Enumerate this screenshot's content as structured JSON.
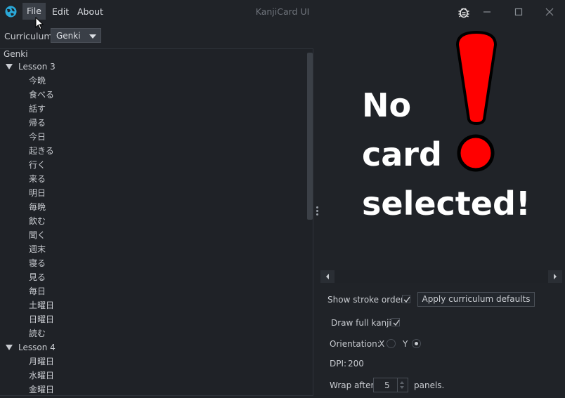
{
  "window": {
    "title": "KanjiCard UI",
    "menu": [
      "File",
      "Edit",
      "About"
    ]
  },
  "curriculum": {
    "label": "Curriculum",
    "selected": "Genki"
  },
  "tree": {
    "root": "Genki",
    "lessons": [
      {
        "label": "Lesson 3",
        "items": [
          "今晩",
          "食べる",
          "話す",
          "帰る",
          "今日",
          "起きる",
          "行く",
          "来る",
          "明日",
          "毎晩",
          "飲む",
          "聞く",
          "週末",
          "寝る",
          "見る",
          "毎日",
          "土曜日",
          "日曜日",
          "読む"
        ]
      },
      {
        "label": "Lesson 4",
        "items": [
          "月曜日",
          "水曜日",
          "金曜日"
        ]
      }
    ]
  },
  "preview": {
    "message_lines": [
      "No",
      "card",
      "selected!"
    ],
    "accent_color": "#ff0000"
  },
  "options": {
    "stroke_order_label": "Show stroke order?",
    "stroke_order_checked": true,
    "apply_button": "Apply curriculum defaults",
    "full_kanji_label": "Draw full kanji?",
    "full_kanji_checked": true,
    "orientation_label": "Orientation:",
    "orientation_x": "X",
    "orientation_y": "Y",
    "orientation_selected": "Y",
    "dpi_label": "DPI:",
    "dpi_value": "200",
    "wrap_label": "Wrap after",
    "wrap_value": "5",
    "wrap_suffix": "panels."
  }
}
